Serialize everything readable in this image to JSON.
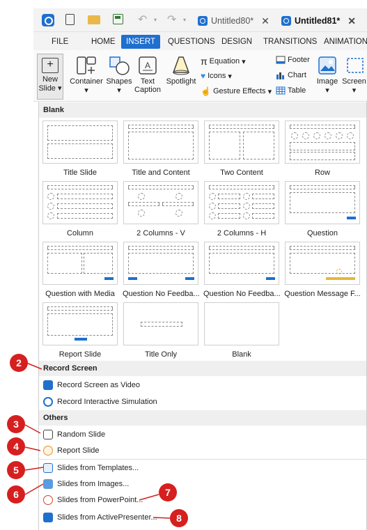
{
  "titlebar": {
    "tabs": [
      {
        "label": "Untitled80*",
        "active": false
      },
      {
        "label": "Untitled81*",
        "active": true
      }
    ],
    "close_glyph": "✕"
  },
  "ribbon_tabs": [
    "FILE",
    "HOME",
    "INSERT",
    "QUESTIONS",
    "DESIGN",
    "TRANSITIONS",
    "ANIMATIONS"
  ],
  "active_tab": "INSERT",
  "ribbon": {
    "new_slide": {
      "line1": "New",
      "line2": "Slide"
    },
    "container": "Container",
    "shapes": "Shapes",
    "text_caption": {
      "line1": "Text",
      "line2": "Caption"
    },
    "spotlight": "Spotlight",
    "equation": "Equation",
    "icons": "Icons",
    "gesture_effects": "Gesture Effects",
    "footer": "Footer",
    "chart": "Chart",
    "table": "Table",
    "image": "Image",
    "screen": "Screen"
  },
  "gallery": {
    "blank_header": "Blank",
    "layouts": [
      "Title Slide",
      "Title and Content",
      "Two Content",
      "Row",
      "Column",
      "2 Columns - V",
      "2 Columns - H",
      "Question",
      "Question with Media",
      "Question No Feedba...",
      "Question No Feedba...",
      "Question Message F...",
      "Report Slide",
      "Title Only",
      "Blank"
    ],
    "record_header": "Record Screen",
    "record_items": [
      "Record Screen as Video",
      "Record Interactive Simulation"
    ],
    "others_header": "Others",
    "others_items": [
      "Random Slide",
      "Report Slide"
    ],
    "from_items": [
      "Slides from Templates...",
      "Slides from Images...",
      "Slides from PowerPoint...",
      "Slides from ActivePresenter..."
    ]
  },
  "callouts": [
    "2",
    "3",
    "4",
    "5",
    "6",
    "7",
    "8"
  ],
  "colors": {
    "accent": "#1f6fcf",
    "callout": "#d61f1f",
    "highlight": "#e5b838"
  }
}
